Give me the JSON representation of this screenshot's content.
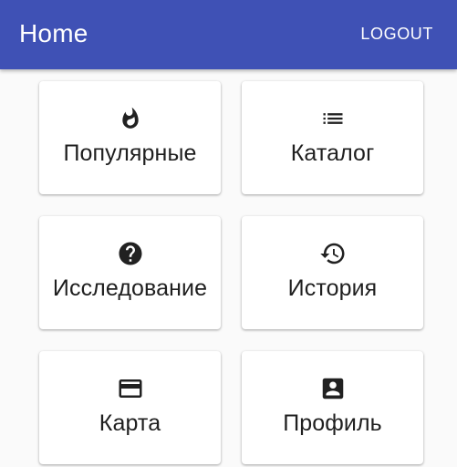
{
  "appbar": {
    "title": "Home",
    "logout_label": "LOGOUT",
    "color": "#3f51b5"
  },
  "cards": [
    {
      "label": "Популярные",
      "icon": "fire-icon"
    },
    {
      "label": "Каталог",
      "icon": "list-icon"
    },
    {
      "label": "Исследование",
      "icon": "help-circle-icon"
    },
    {
      "label": "История",
      "icon": "history-icon"
    },
    {
      "label": "Карта",
      "icon": "credit-card-icon"
    },
    {
      "label": "Профиль",
      "icon": "account-box-icon"
    }
  ]
}
